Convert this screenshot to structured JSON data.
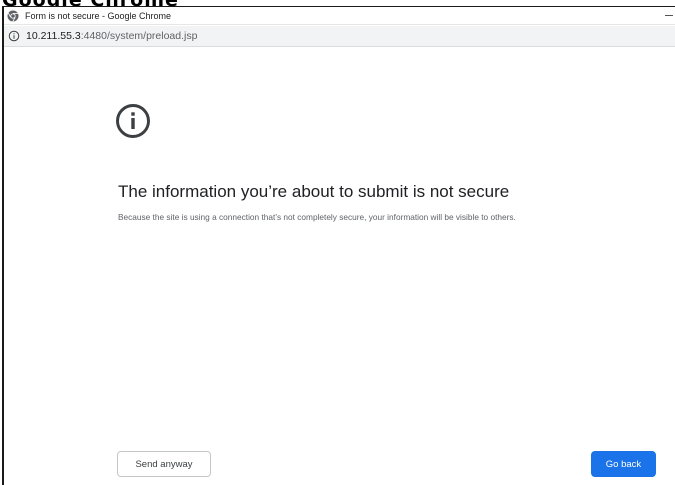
{
  "window": {
    "title": "Form is not secure - Google Chrome",
    "cut_off_header": "Google Chrome"
  },
  "address_bar": {
    "url_host": "10.211.55.3",
    "url_rest": ":4480/system/preload.jsp"
  },
  "interstitial": {
    "icon": "info-circle-icon",
    "heading": "The information you’re about to submit is not secure",
    "description": "Because the site is using a connection that’s not completely secure, your information will be visible to others."
  },
  "buttons": {
    "send_anyway": "Send anyway",
    "go_back": "Go back"
  },
  "colors": {
    "primary_button": "#1a73e8",
    "heading_text": "#202124",
    "body_text": "#5f6368"
  }
}
